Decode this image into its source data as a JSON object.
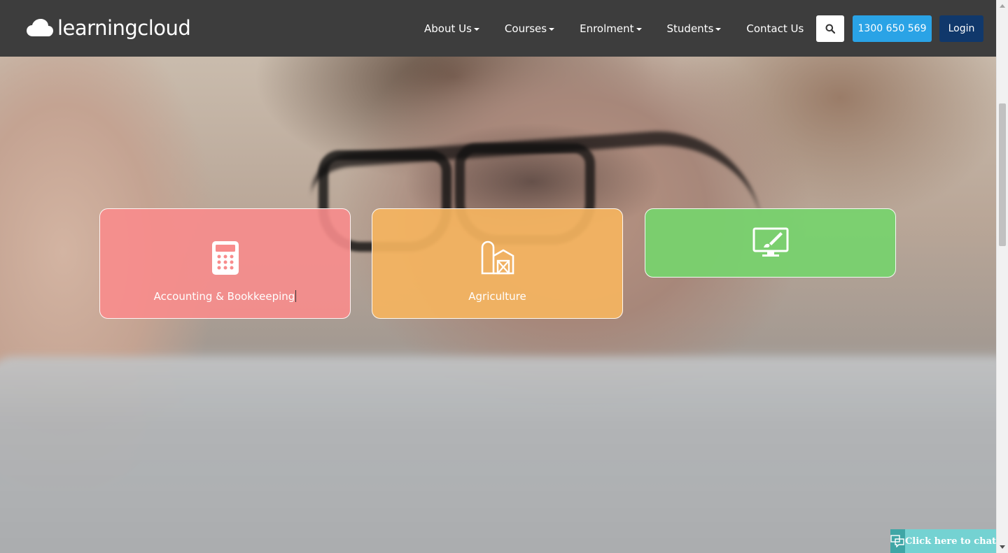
{
  "header": {
    "logo_text": "learningcloud",
    "nav": [
      {
        "label": "About Us",
        "has_dropdown": true
      },
      {
        "label": "Courses",
        "has_dropdown": true
      },
      {
        "label": "Enrolment",
        "has_dropdown": true
      },
      {
        "label": "Students",
        "has_dropdown": true
      },
      {
        "label": "Contact Us",
        "has_dropdown": false
      }
    ],
    "search_icon": "search-icon",
    "phone_label": "1300 650 569",
    "login_label": "Login",
    "colors": {
      "bar": "#3d3d3d",
      "phone": "#2aa3e6",
      "login": "#10386b"
    }
  },
  "categories": [
    {
      "label": "Accounting & Bookkeeping",
      "icon": "calculator-icon",
      "color": "#f88c8c"
    },
    {
      "label": "Agriculture",
      "icon": "barn-icon",
      "color": "#f5b45f"
    },
    {
      "label": "",
      "icon": "design-monitor-icon",
      "color": "#78d26e"
    }
  ],
  "chat": {
    "label": "Click here to chat",
    "icon": "chat-bubble-icon"
  }
}
